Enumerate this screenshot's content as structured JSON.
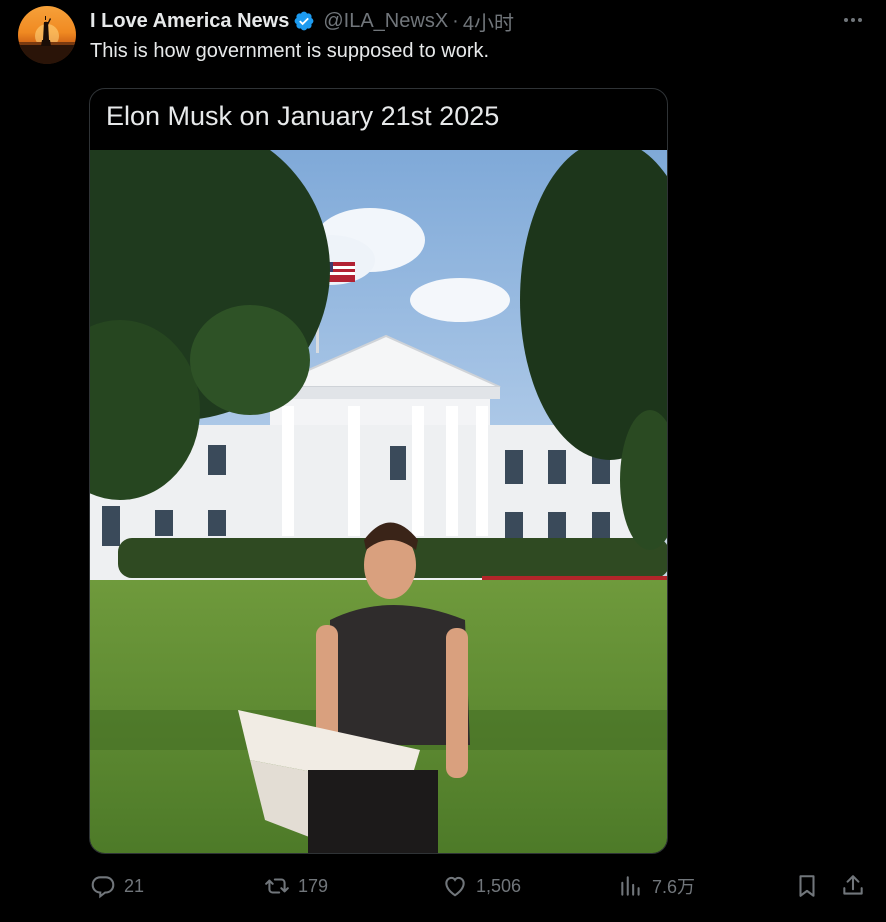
{
  "author": {
    "name": "I Love America News",
    "handle": "@ILA_NewsX",
    "separator": "·",
    "time": "4小时",
    "verified": true,
    "avatar_icon": "statue-of-liberty-sunset-avatar"
  },
  "tweet": {
    "text": "This is how government is supposed to work."
  },
  "media": {
    "caption": "Elon Musk on January 21st 2025",
    "image_description_icon": "white-house-lawn-photo"
  },
  "actions": {
    "replies": "21",
    "reposts": "179",
    "likes": "1,506",
    "views": "7.6万"
  },
  "colors": {
    "background": "#000000",
    "text_primary": "#e7e9ea",
    "text_secondary": "#71767b",
    "verified_badge": "#1d9bf0",
    "border": "#2f3336"
  }
}
